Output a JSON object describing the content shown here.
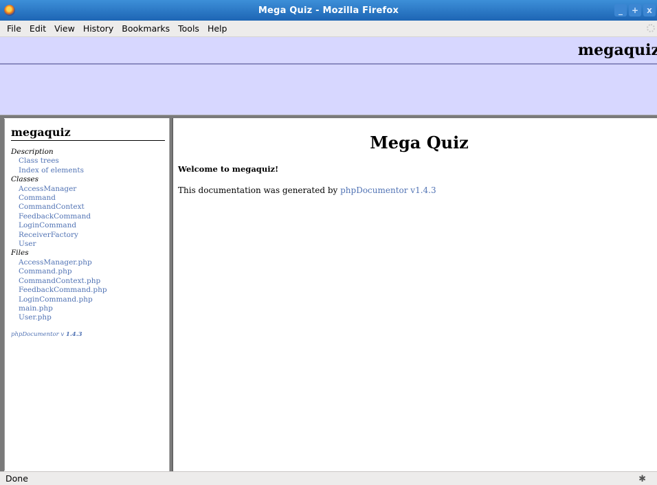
{
  "window": {
    "title": "Mega Quiz - Mozilla Firefox",
    "buttons": {
      "minimize": "_",
      "maximize": "+",
      "close": "x"
    }
  },
  "menubar": {
    "items": [
      {
        "label": "File"
      },
      {
        "label": "Edit"
      },
      {
        "label": "View"
      },
      {
        "label": "History"
      },
      {
        "label": "Bookmarks"
      },
      {
        "label": "Tools"
      },
      {
        "label": "Help"
      }
    ]
  },
  "header": {
    "title": "megaquiz"
  },
  "sidebar": {
    "package_title": "megaquiz",
    "sections": [
      {
        "heading": "Description",
        "links": [
          "Class trees",
          "Index of elements"
        ]
      },
      {
        "heading": "Classes",
        "links": [
          "AccessManager",
          "Command",
          "CommandContext",
          "FeedbackCommand",
          "LoginCommand",
          "ReceiverFactory",
          "User"
        ]
      },
      {
        "heading": "Files",
        "links": [
          "AccessManager.php",
          "Command.php",
          "CommandContext.php",
          "FeedbackCommand.php",
          "LoginCommand.php",
          "main.php",
          "User.php"
        ]
      }
    ],
    "footer": {
      "prefix": "phpDocumentor v ",
      "version": "1.4.3"
    }
  },
  "main": {
    "title": "Mega Quiz",
    "welcome": "Welcome to megaquiz!",
    "generated_prefix": "This documentation was generated by ",
    "generated_link": "phpDocumentor v1.4.3"
  },
  "statusbar": {
    "text": "Done"
  },
  "colors": {
    "titlebar": "#1d65b4",
    "header_band": "#d7d7ff",
    "link": "#5173b4"
  }
}
